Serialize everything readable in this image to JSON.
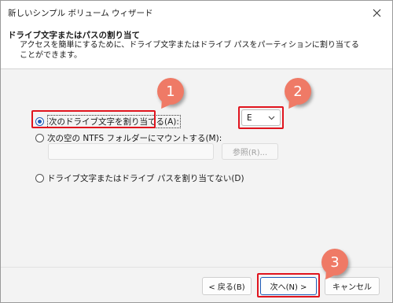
{
  "window": {
    "title": "新しいシンプル ボリューム ウィザード"
  },
  "header": {
    "title": "ドライブ文字またはパスの割り当て",
    "description": "アクセスを簡単にするために、ドライブ文字またはドライブ パスをパーティションに割り当てることができます。"
  },
  "options": {
    "assign_letter_label": "次のドライブ文字を割り当てる(A):",
    "mount_folder_label": "次の空の NTFS フォルダーにマウントする(M):",
    "no_assign_label": "ドライブ文字またはドライブ パスを割り当てない(D)",
    "selected": "assign_letter"
  },
  "drive_letter": {
    "value": "E"
  },
  "folder_path": {
    "value": "",
    "browse_label": "参照(R)..."
  },
  "footer": {
    "back_label": "< 戻る(B)",
    "next_label": "次へ(N) >",
    "cancel_label": "キャンセル"
  },
  "annotations": {
    "badge_1": "1",
    "badge_2": "2",
    "badge_3": "3",
    "highlight_color": "#e0141e",
    "badge_color": "#ef7a66"
  },
  "icons": {
    "close": "close-icon",
    "dropdown": "chevron-down-icon"
  }
}
